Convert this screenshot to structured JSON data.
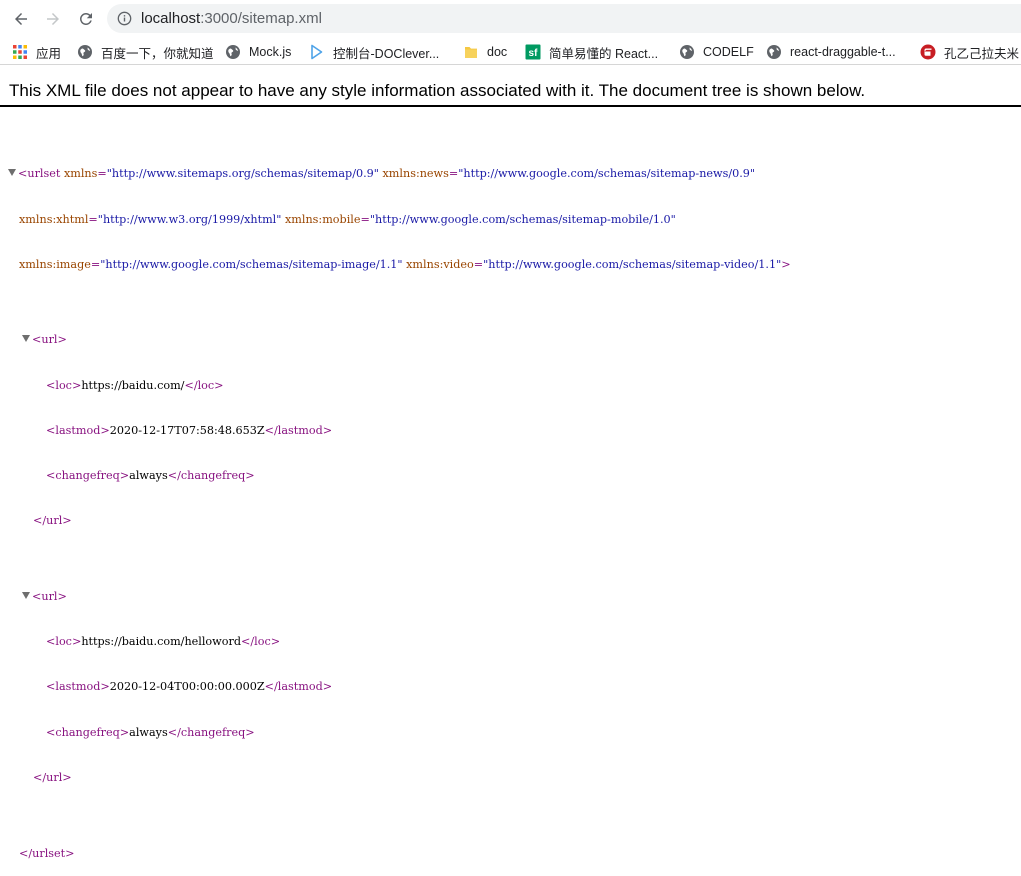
{
  "browser": {
    "url_host": "localhost",
    "url_path": ":3000/sitemap.xml"
  },
  "bookmarks": [
    {
      "label": "应用",
      "icon": "apps-grid-icon"
    },
    {
      "label": "百度一下，你就知道",
      "icon": "globe-icon"
    },
    {
      "label": "Mock.js",
      "icon": "globe-icon"
    },
    {
      "label": "控制台-DOClever...",
      "icon": "doclever-icon"
    },
    {
      "label": "doc",
      "icon": "folder-icon"
    },
    {
      "label": "简单易懂的 React...",
      "icon": "segmentfault-icon"
    },
    {
      "label": "CODELF",
      "icon": "globe-icon"
    },
    {
      "label": "react-draggable-t...",
      "icon": "globe-icon"
    },
    {
      "label": "孔乙己拉夫米",
      "icon": "gitee-icon"
    }
  ],
  "xml_notice": "This XML file does not appear to have any style information associated with it. The document tree is shown below.",
  "xml": {
    "root_open_1": "<urlset",
    "ns_attr": "xmlns",
    "ns_val": "\"http://www.sitemaps.org/schemas/sitemap/0.9\"",
    "news_attr": "xmlns:news",
    "news_val": "\"http://www.google.com/schemas/sitemap-news/0.9\"",
    "xhtml_attr": "xmlns:xhtml",
    "xhtml_val": "\"http://www.w3.org/1999/xhtml\"",
    "mobile_attr": "xmlns:mobile",
    "mobile_val": "\"http://www.google.com/schemas/sitemap-mobile/1.0\"",
    "image_attr": "xmlns:image",
    "image_val": "\"http://www.google.com/schemas/sitemap-image/1.1\"",
    "video_attr": "xmlns:video",
    "video_val": "\"http://www.google.com/schemas/sitemap-video/1.1\"",
    "root_close": "</urlset>",
    "urls": [
      {
        "loc": "https://baidu.com/",
        "lastmod": "2020-12-17T07:58:48.653Z",
        "changefreq": "always"
      },
      {
        "loc": "https://baidu.com/helloword",
        "lastmod": "2020-12-04T00:00:00.000Z",
        "changefreq": "always"
      }
    ],
    "tag_url_open": "<url>",
    "tag_url_close": "</url>",
    "tag_loc_open": "<loc>",
    "tag_loc_close": "</loc>",
    "tag_lastmod_open": "<lastmod>",
    "tag_lastmod_close": "</lastmod>",
    "tag_changefreq_open": "<changefreq>",
    "tag_changefreq_close": "</changefreq>"
  },
  "colors": {
    "tag": "#881280",
    "attribute": "#994500",
    "value": "#1a1aa6"
  }
}
